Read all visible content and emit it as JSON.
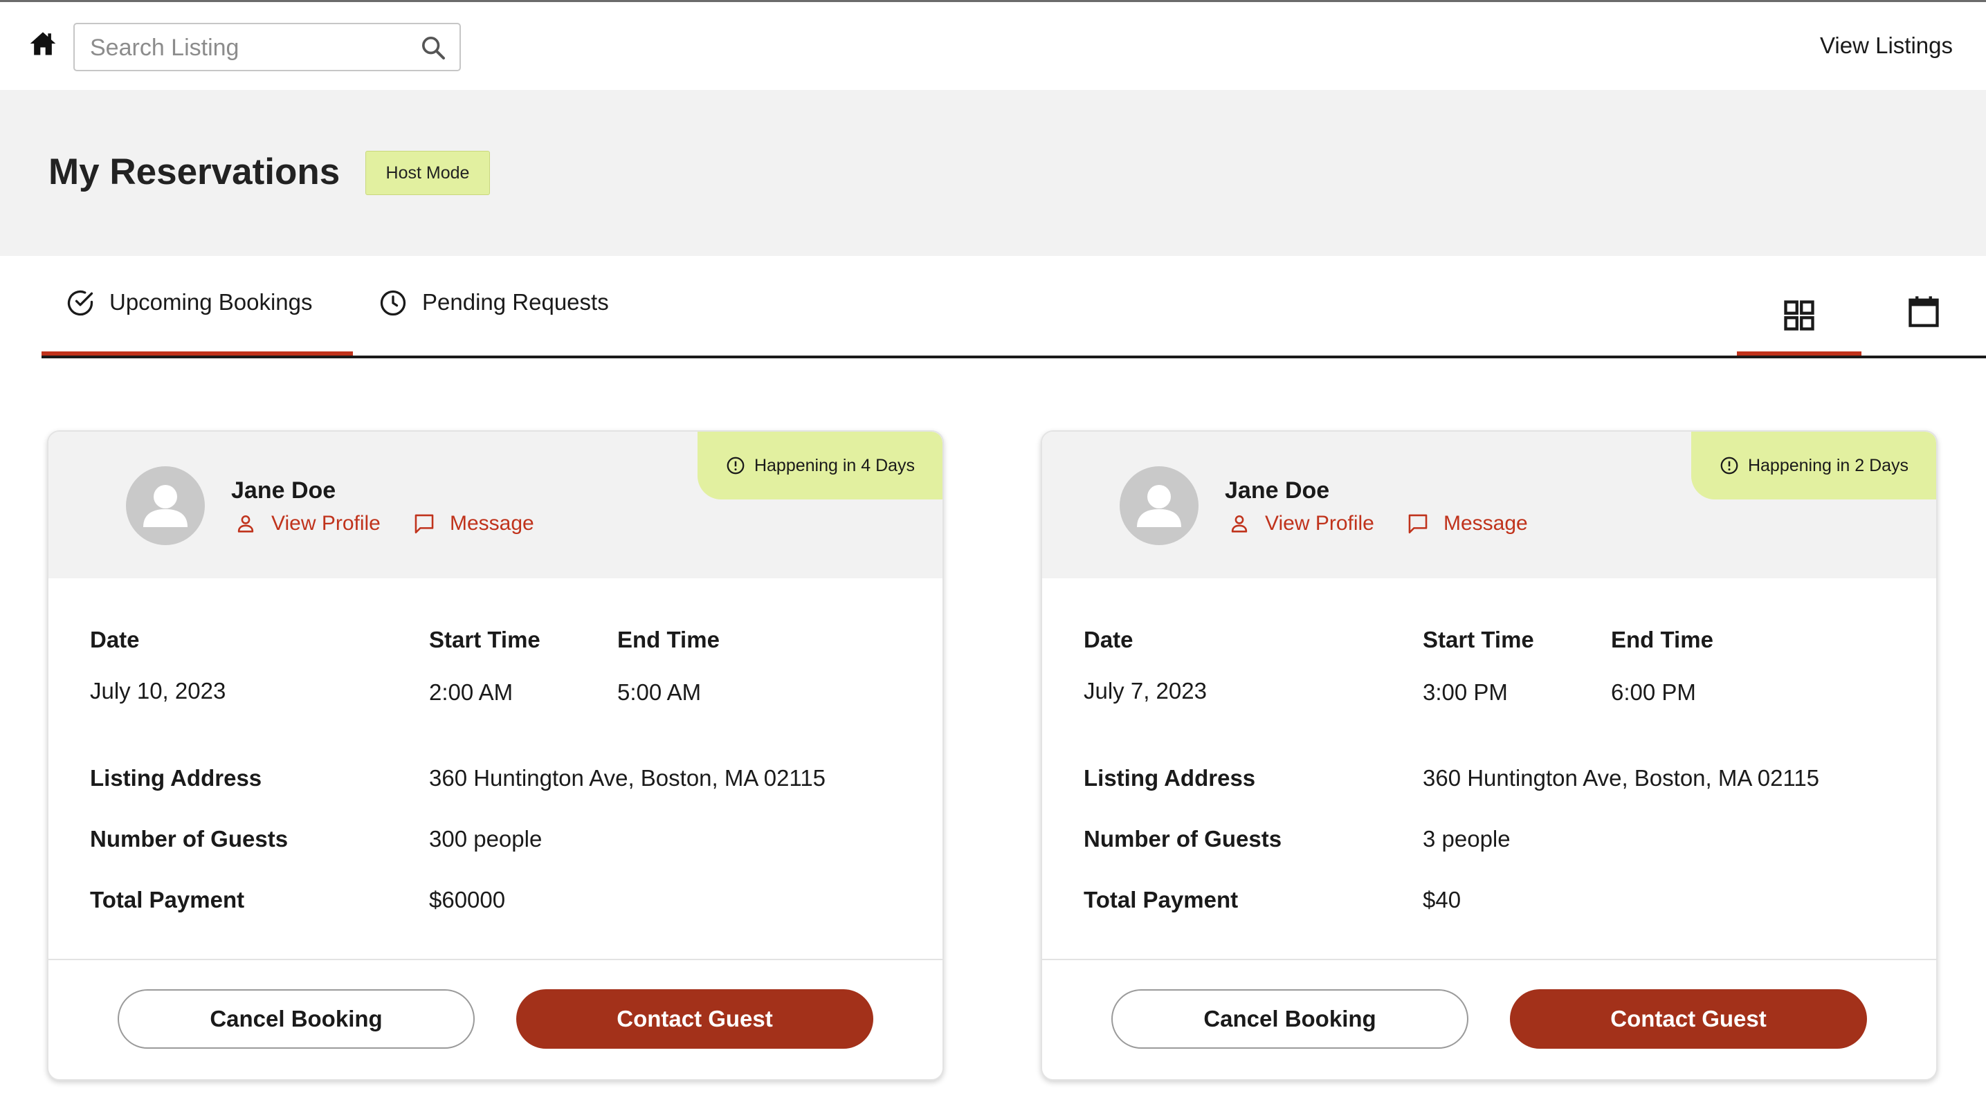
{
  "nav": {
    "search_placeholder": "Search Listing",
    "view_listings": "View Listings"
  },
  "header": {
    "title": "My Reservations",
    "mode_badge": "Host Mode"
  },
  "tabs": [
    {
      "label": "Upcoming Bookings",
      "active": true
    },
    {
      "label": "Pending Requests",
      "active": false
    }
  ],
  "view_modes": {
    "active": "grid",
    "options": [
      "grid-view-icon",
      "calendar-view-icon"
    ]
  },
  "labels": {
    "date": "Date",
    "start_time": "Start Time",
    "end_time": "End Time",
    "listing_address": "Listing Address",
    "number_of_guests": "Number of Guests",
    "total_payment": "Total Payment",
    "view_profile": "View Profile",
    "message": "Message",
    "cancel_booking": "Cancel Booking",
    "contact_guest": "Contact Guest"
  },
  "bookings": [
    {
      "guest_name": "Jane Doe",
      "countdown": "Happening in 4 Days",
      "date": "July 10, 2023",
      "start_time": "2:00 AM",
      "end_time": "5:00 AM",
      "address": "360 Huntington Ave, Boston, MA 02115",
      "guests": "300 people",
      "payment": "$60000"
    },
    {
      "guest_name": "Jane Doe",
      "countdown": "Happening in 2 Days",
      "date": "July 7, 2023",
      "start_time": "3:00 PM",
      "end_time": "6:00 PM",
      "address": "360 Huntington Ave, Boston, MA 02115",
      "guests": "3 people",
      "payment": "$40"
    }
  ],
  "colors": {
    "accent": "#c0331c",
    "primary_button": "#a3311a",
    "badge_bg": "#e2f0a0",
    "header_bg": "#f2f2f2"
  }
}
